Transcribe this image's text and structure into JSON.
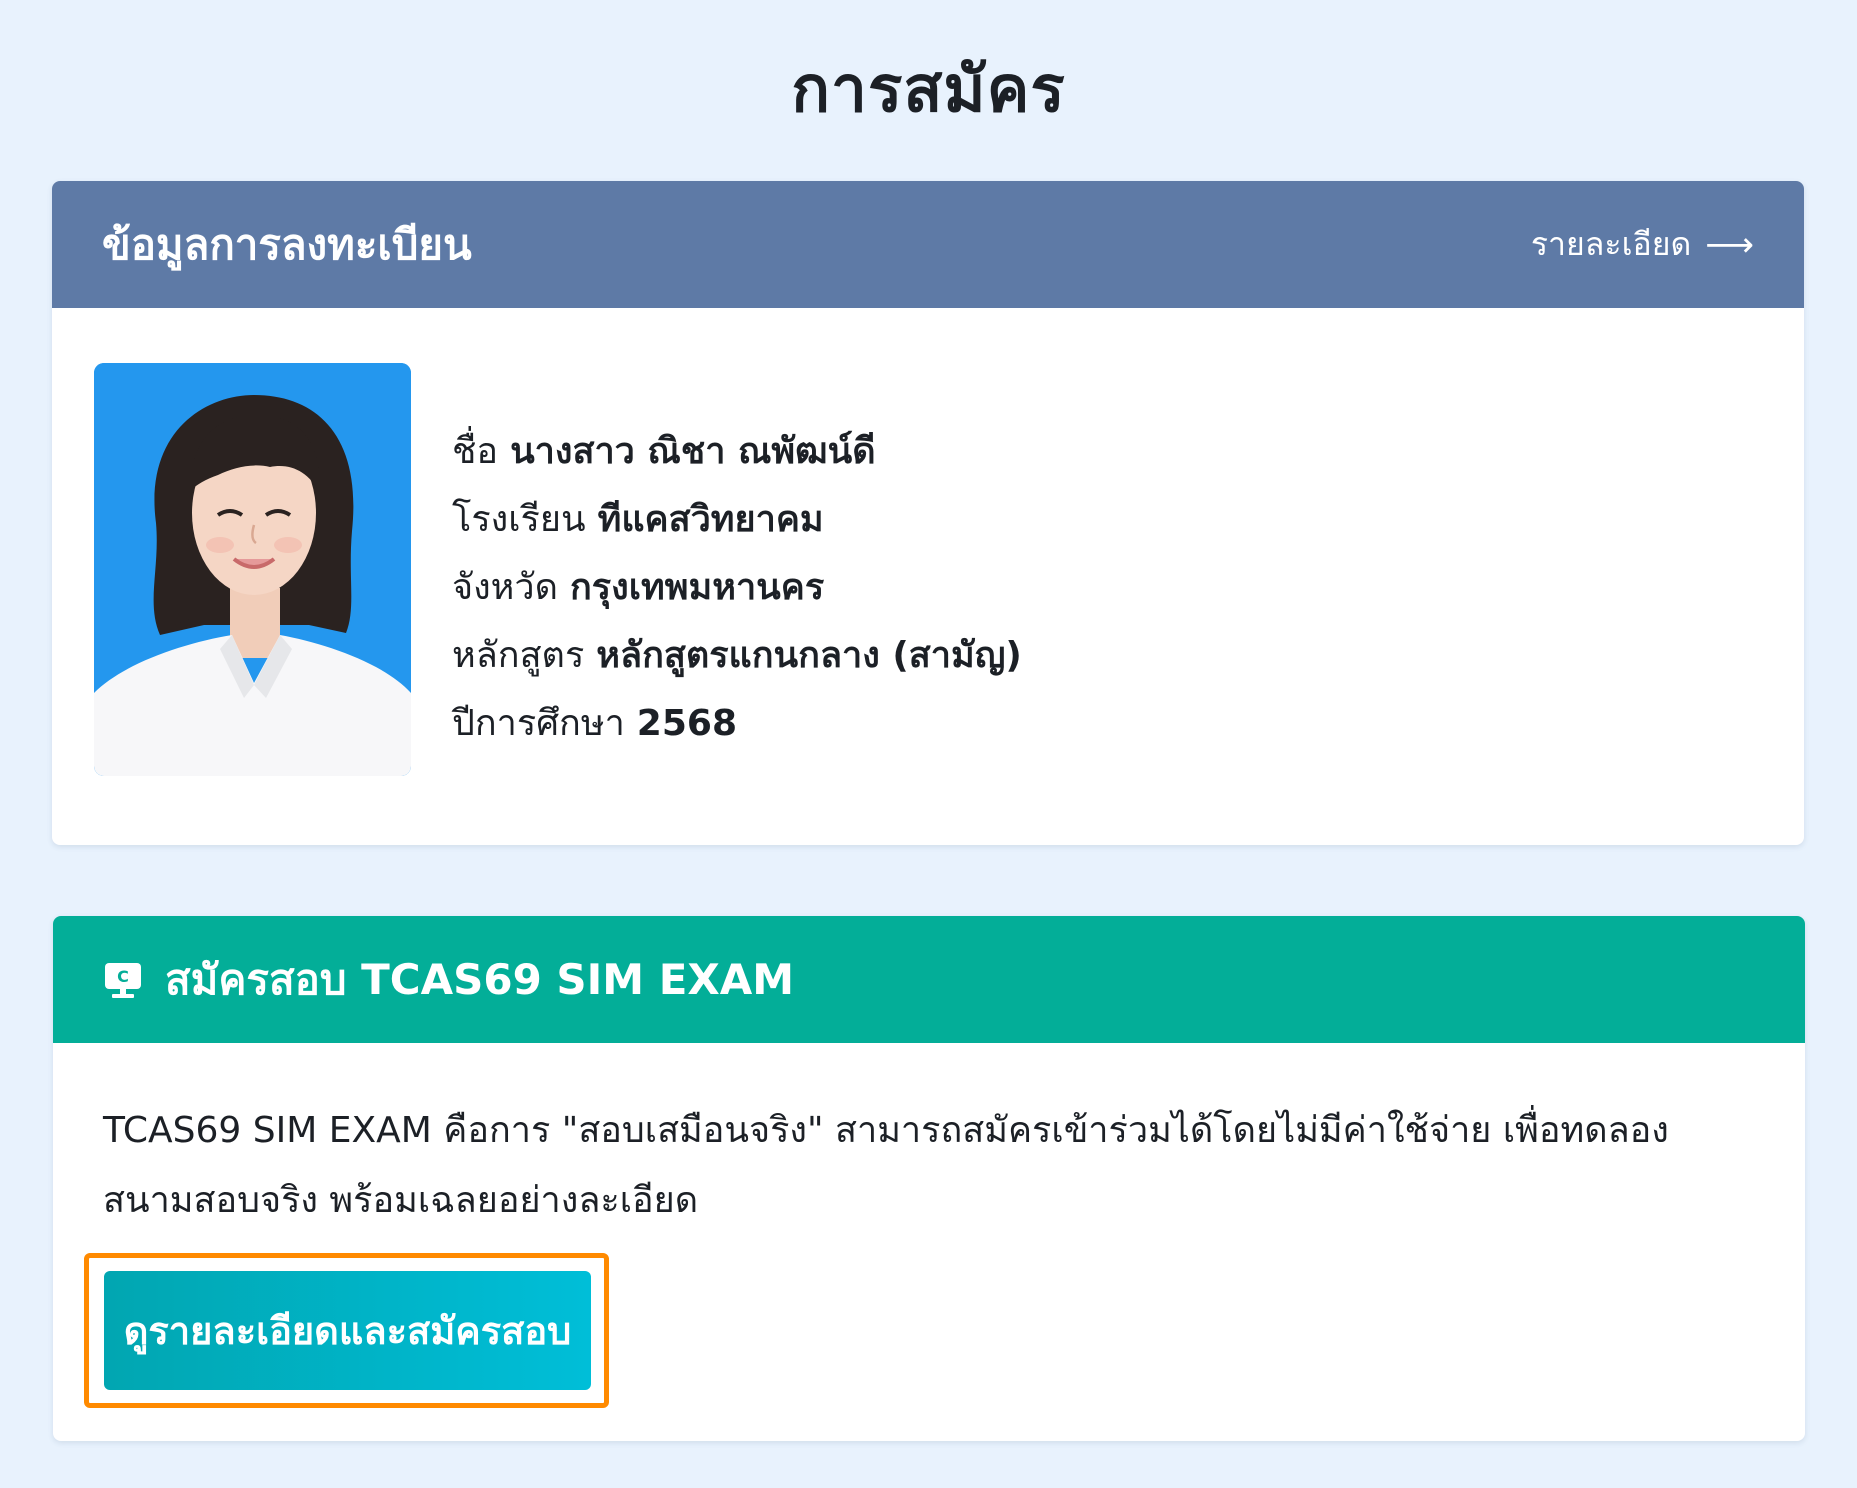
{
  "page": {
    "title": "การสมัคร"
  },
  "registration": {
    "title": "ข้อมูลการลงทะเบียน",
    "details_link": "รายละเอียด",
    "fields": [
      {
        "label": "ชื่อ",
        "value": "นางสาว ณิชา ณพัฒน์ดี"
      },
      {
        "label": "โรงเรียน",
        "value": "ทีแคสวิทยาคม"
      },
      {
        "label": "จังหวัด",
        "value": "กรุงเทพมหานคร"
      },
      {
        "label": "หลักสูตร",
        "value": "หลักสูตรแกนกลาง (สามัญ)"
      },
      {
        "label": "ปีการศึกษา",
        "value": "2568"
      }
    ]
  },
  "sim_exam": {
    "title": "สมัครสอบ TCAS69 SIM EXAM",
    "description": "TCAS69 SIM EXAM คือการ \"สอบเสมือนจริง\" สามารถสมัครเข้าร่วมได้โดยไม่มีค่าใช้จ่าย เพื่อทดลองสนามสอบจริง พร้อมเฉลยอย่างละเอียด",
    "button_label": "ดูรายละเอียดและสมัครสอบ"
  },
  "colors": {
    "background": "#e8f2fd",
    "registration_header": "#5e7aa6",
    "sim_header": "#03ae98",
    "button_start": "#01a6b1",
    "button_end": "#00bed8",
    "highlight": "#ff8a00",
    "photo_background": "#2497ee"
  },
  "icons": {
    "details_arrow": "arrow-right-icon",
    "sim_header": "computer-exam-icon"
  }
}
